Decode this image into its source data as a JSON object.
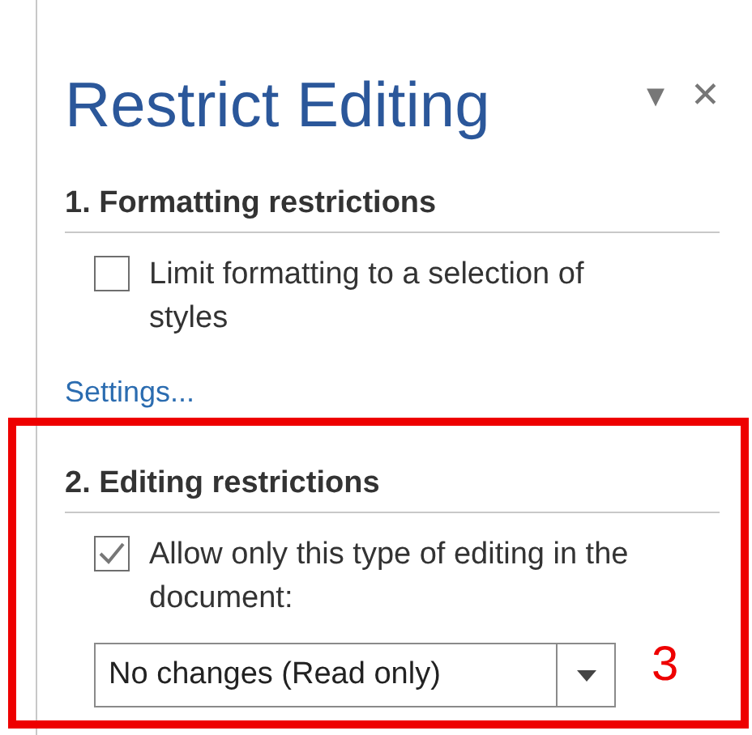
{
  "pane": {
    "title": "Restrict Editing",
    "menu_glyph": "▾",
    "close_glyph": "✕"
  },
  "sections": [
    {
      "heading": "1. Formatting restrictions",
      "option": {
        "label": "Limit formatting to a selection of styles",
        "checked": false
      },
      "link": "Settings..."
    },
    {
      "heading": "2. Editing restrictions",
      "option": {
        "label": "Allow only this type of editing in the document:",
        "checked": true
      },
      "dropdown": {
        "value": "No changes (Read only)"
      }
    }
  ],
  "annotation": {
    "number": "3"
  }
}
